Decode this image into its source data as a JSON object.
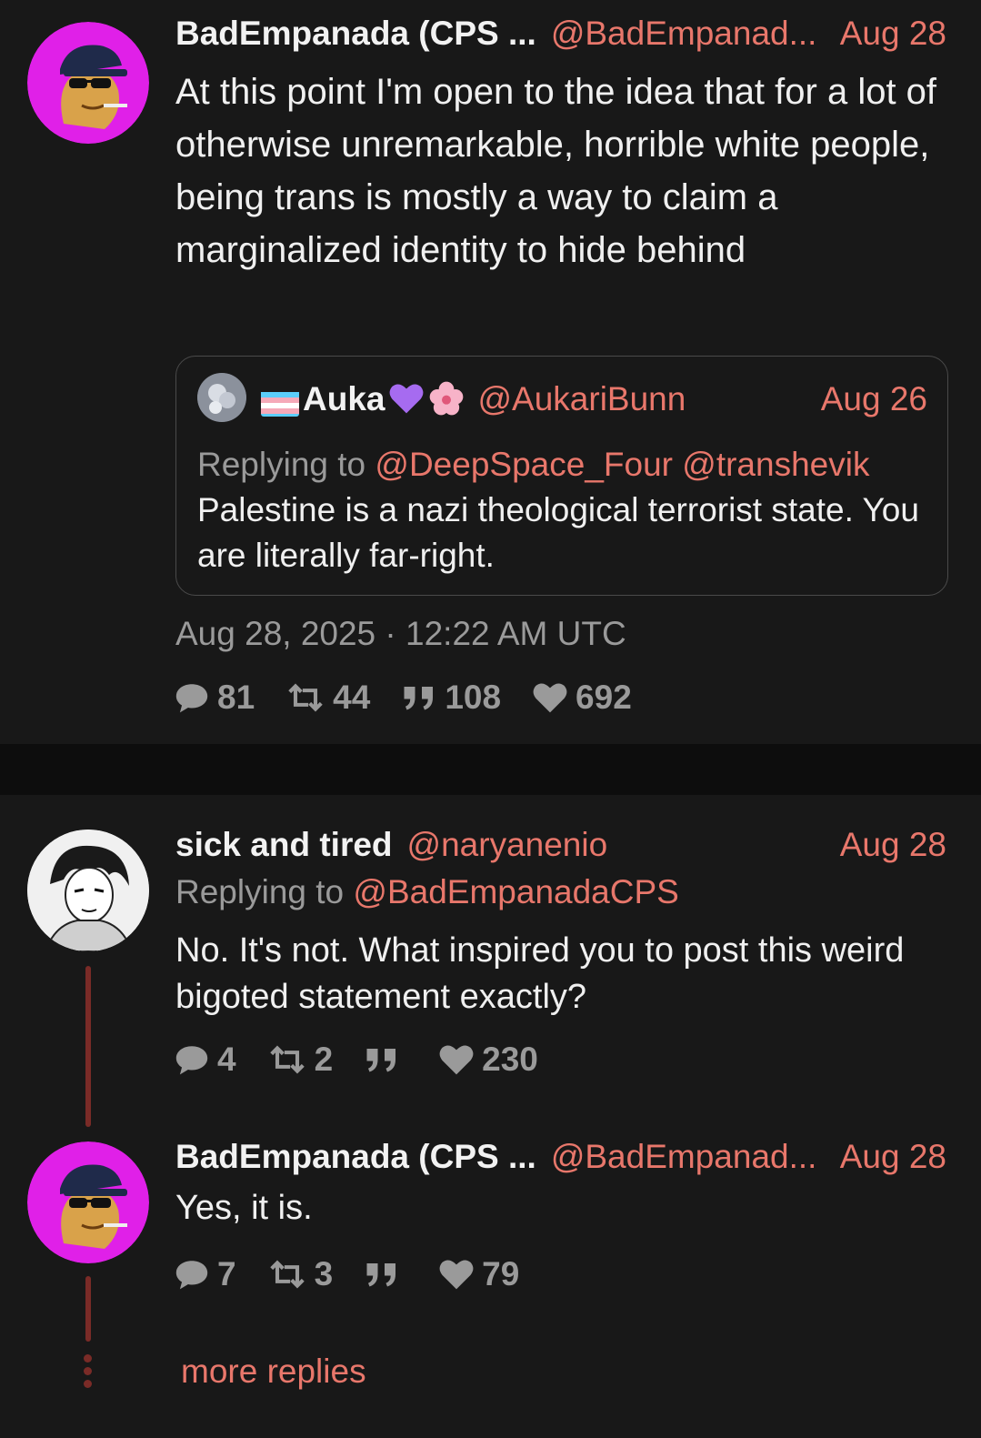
{
  "main_tweet": {
    "author_name": "BadEmpanada (CPS ...",
    "handle": "@BadEmpanad...",
    "date": "Aug 28",
    "text": "At this point I'm open to the idea that for a lot of otherwise unremarkable, horrible white people, being trans is mostly a way to claim a marginalized identity to hide behind",
    "quoted": {
      "author_name": "Auka",
      "handle": "@AukariBunn",
      "date": "Aug 26",
      "replying_label": "Replying to",
      "replying_to": [
        "@DeepSpace_Four",
        "@transhevik"
      ],
      "text": "Palestine is a nazi theological terrorist state. You are literally far-right."
    },
    "timestamp": "Aug 28, 2025 · 12:22 AM UTC",
    "stats": {
      "replies": "81",
      "retweets": "44",
      "quotes": "108",
      "likes": "692"
    }
  },
  "reply_1": {
    "author_name": "sick and tired",
    "handle": "@naryanenio",
    "date": "Aug 28",
    "replying_label": "Replying to",
    "replying_to": "@BadEmpanadaCPS",
    "text": "No. It's not. What inspired you to post this weird bigoted statement exactly?",
    "stats": {
      "replies": "4",
      "retweets": "2",
      "quotes": "",
      "likes": "230"
    }
  },
  "reply_2": {
    "author_name": "BadEmpanada (CPS ...",
    "handle": "@BadEmpanad...",
    "date": "Aug 28",
    "text": "Yes, it is.",
    "stats": {
      "replies": "7",
      "retweets": "3",
      "quotes": "",
      "likes": "79"
    }
  },
  "more_replies_label": "more replies",
  "colors": {
    "accent": "#e8776b",
    "background": "#181818",
    "thread_line": "#7a2b27",
    "avatar_ring": "#e020e8"
  }
}
